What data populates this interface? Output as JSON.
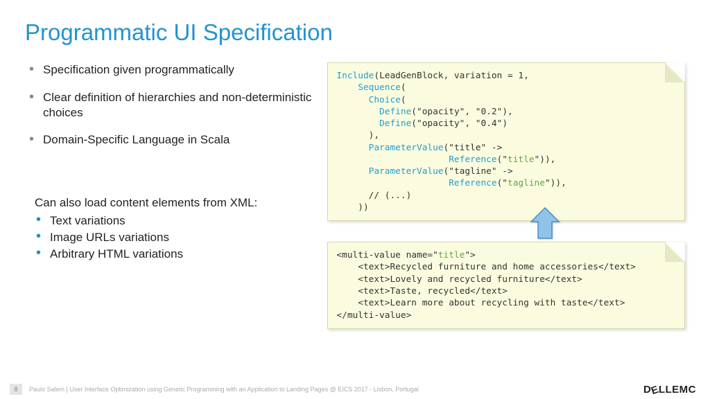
{
  "title": "Programmatic UI Specification",
  "bullets": {
    "b0": "Specification given programmatically",
    "b1": "Clear definition of hierarchies and non-deterministic choices",
    "b2": "Domain-Specific Language in Scala"
  },
  "sub_intro": "Can also load content elements from XML:",
  "sub": {
    "s0": "Text variations",
    "s1": "Image URLs variations",
    "s2": "Arbitrary HTML variations"
  },
  "code1": {
    "l0a": "Include",
    "l0b": "(LeadGenBlock, variation = 1,",
    "l1a": "    Sequence",
    "l1b": "(",
    "l2a": "      Choice",
    "l2b": "(",
    "l3a": "        Define",
    "l3b": "(",
    "l3c": "\"opacity\"",
    "l3d": ", ",
    "l3e": "\"0.2\"",
    "l3f": "),",
    "l4a": "        Define",
    "l4b": "(",
    "l4c": "\"opacity\"",
    "l4d": ", ",
    "l4e": "\"0.4\"",
    "l4f": ")",
    "l5": "      ),",
    "l6a": "      ParameterValue",
    "l6b": "(",
    "l6c": "\"title\"",
    "l6d": " ->",
    "l7a": "                     Reference",
    "l7b": "(",
    "l7c": "\"",
    "l7d": "title",
    "l7e": "\"",
    "l7f": ")),",
    "l8a": "      ParameterValue",
    "l8b": "(",
    "l8c": "\"tagline\"",
    "l8d": " ->",
    "l9a": "                     Reference",
    "l9b": "(",
    "l9c": "\"",
    "l9d": "tagline",
    "l9e": "\"",
    "l9f": ")),",
    "l10": "      // (...)",
    "l11": "    ))"
  },
  "code2": {
    "l0a": "<multi-value name=\"",
    "l0b": "title",
    "l0c": "\">",
    "l1": "    <text>Recycled furniture and home accessories</text>",
    "l2": "    <text>Lovely and recycled furniture</text>",
    "l3": "    <text>Taste, recycled</text>",
    "l4": "    <text>Learn more about recycling with taste</text>",
    "l5": "</multi-value>"
  },
  "footer": {
    "page": "8",
    "text": "Paulo Salem | User Interface Optimization using Genetic Programming with an Application to Landing Pages  @  EICS 2017 - Lisbon, Portugal",
    "logo1": "D",
    "logo2": "LLEMC"
  }
}
